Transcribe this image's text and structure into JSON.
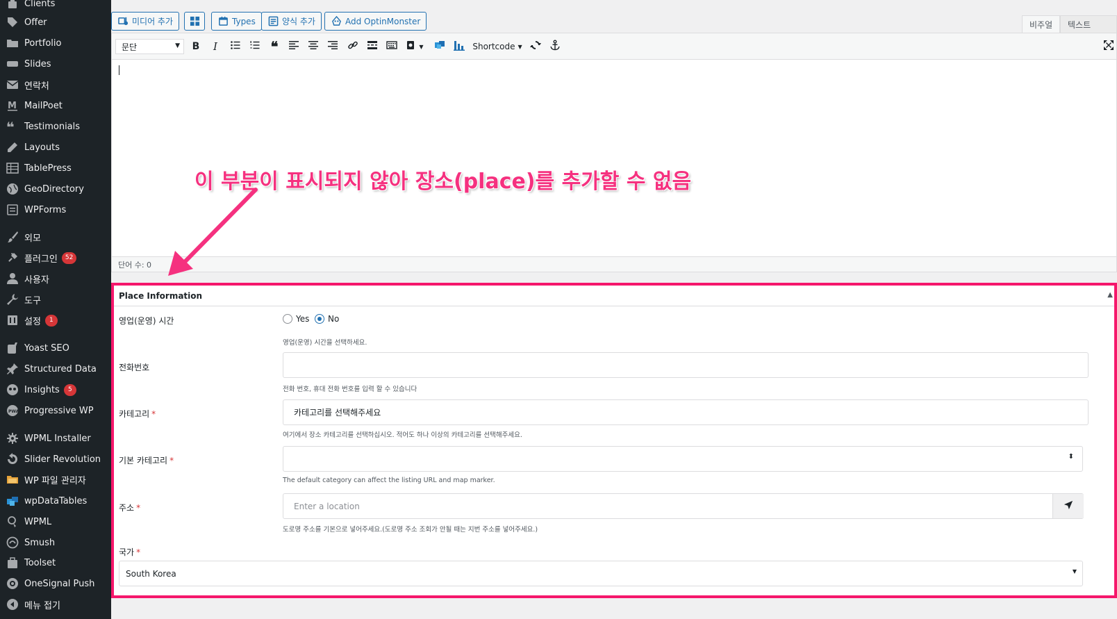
{
  "sidebar": {
    "items": [
      {
        "label": "Clients",
        "icon": "clients-icon",
        "badge": ""
      },
      {
        "label": "Offer",
        "icon": "tag-icon",
        "badge": ""
      },
      {
        "label": "Portfolio",
        "icon": "folder-icon",
        "badge": ""
      },
      {
        "label": "Slides",
        "icon": "slides-icon",
        "badge": ""
      },
      {
        "label": "연락처",
        "icon": "mail-icon",
        "badge": ""
      },
      {
        "label": "MailPoet",
        "icon": "mailpoet-icon",
        "badge": ""
      },
      {
        "label": "Testimonials",
        "icon": "quote-icon",
        "badge": ""
      },
      {
        "label": "Layouts",
        "icon": "pencil-icon",
        "badge": ""
      },
      {
        "label": "TablePress",
        "icon": "table-icon",
        "badge": ""
      },
      {
        "label": "GeoDirectory",
        "icon": "globe-icon",
        "badge": ""
      },
      {
        "label": "WPForms",
        "icon": "form-icon",
        "badge": ""
      },
      {
        "label": "외모",
        "icon": "brush-icon",
        "badge": ""
      },
      {
        "label": "플러그인",
        "icon": "plugin-icon",
        "badge": "52"
      },
      {
        "label": "사용자",
        "icon": "user-icon",
        "badge": ""
      },
      {
        "label": "도구",
        "icon": "wrench-icon",
        "badge": ""
      },
      {
        "label": "설정",
        "icon": "settings-icon",
        "badge": "1"
      },
      {
        "label": "Yoast SEO",
        "icon": "yoast-icon",
        "badge": ""
      },
      {
        "label": "Structured Data",
        "icon": "pin-icon",
        "badge": ""
      },
      {
        "label": "Insights",
        "icon": "insights-icon",
        "badge": "5"
      },
      {
        "label": "Progressive WP",
        "icon": "pwa-icon",
        "badge": ""
      },
      {
        "label": "WPML Installer",
        "icon": "gear-icon",
        "badge": ""
      },
      {
        "label": "Slider Revolution",
        "icon": "refresh-icon",
        "badge": ""
      },
      {
        "label": "WP 파일 관리자",
        "icon": "file-manager-icon",
        "badge": ""
      },
      {
        "label": "wpDataTables",
        "icon": "datatables-icon",
        "badge": ""
      },
      {
        "label": "WPML",
        "icon": "wpml-icon",
        "badge": ""
      },
      {
        "label": "Smush",
        "icon": "smush-icon",
        "badge": ""
      },
      {
        "label": "Toolset",
        "icon": "toolset-icon",
        "badge": ""
      },
      {
        "label": "OneSignal Push",
        "icon": "onesignal-icon",
        "badge": ""
      },
      {
        "label": "메뉴 접기",
        "icon": "collapse-icon",
        "badge": ""
      }
    ]
  },
  "media_buttons": {
    "add_media": "미디어 추가",
    "types": "Types",
    "add_form": "양식 추가",
    "optinmonster": "Add OptinMonster"
  },
  "view_tabs": {
    "visual": "비주얼",
    "text": "텍스트"
  },
  "toolbar": {
    "format_value": "문단",
    "shortcode": "Shortcode"
  },
  "editor": {
    "word_count": "단어 수: 0"
  },
  "annotation": {
    "text": "이 부분이 표시되지 않아 장소(place)를 추가할 수 없음",
    "color": "#f5317f"
  },
  "place_info": {
    "title": "Place Information",
    "hours": {
      "label": "영업(운영) 시간",
      "yes": "Yes",
      "no": "No",
      "selected": "No",
      "desc": "영업(운영) 시간을 선택하세요."
    },
    "phone": {
      "label": "전화번호",
      "value": "",
      "desc": "전화 번호, 휴대 전화 번호를 입력 할 수 있습니다"
    },
    "category": {
      "label": "카테고리",
      "required": "*",
      "placeholder": "카테고리를 선택해주세요",
      "desc": "여기에서 장소 카테고리를 선택하십시오. 적어도 하나 이상의 카테고리를 선택해주세요."
    },
    "default_category": {
      "label": "기본 카테고리",
      "required": "*",
      "value": "",
      "desc": "The default category can affect the listing URL and map marker."
    },
    "address": {
      "label": "주소",
      "required": "*",
      "placeholder": "Enter a location",
      "desc": "도로명 주소를 기본으로 넣어주세요.(도로명 주소 조회가 안될 때는 지번 주소를 넣어주세요.)"
    },
    "country": {
      "label": "국가",
      "required": "*",
      "value": "South Korea"
    }
  },
  "colors": {
    "highlight_border": "#f5176b",
    "accent": "#2271b1",
    "sidebar_bg": "#1d2327",
    "badge": "#d63638"
  }
}
